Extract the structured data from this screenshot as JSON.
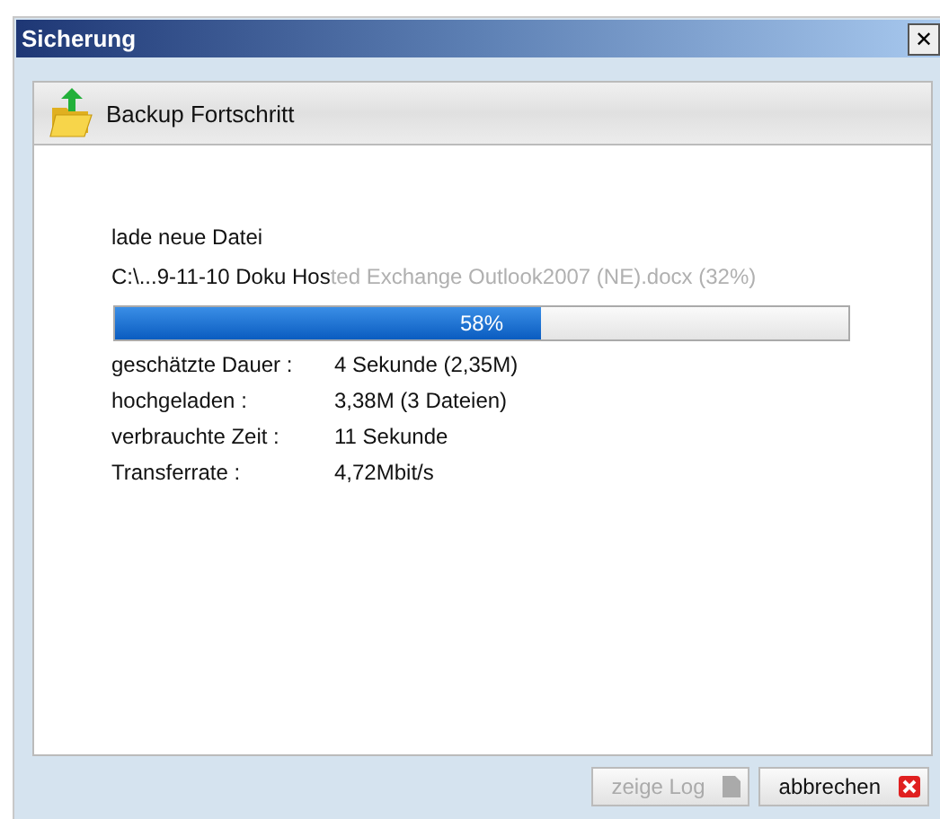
{
  "window": {
    "title": "Sicherung",
    "close": "✕"
  },
  "header": {
    "title": "Backup Fortschritt"
  },
  "status": "lade neue Datei",
  "file": {
    "done_part": "C:\\...9-11-10 Doku Hos",
    "rest_part": "ted Exchange Outlook2007 (NE).docx (32%)"
  },
  "progress": {
    "level": 0.58,
    "reading": "58%"
  },
  "stats": [
    {
      "label": "geschätzte Dauer :",
      "value": "4 Sekunde (2,35M)"
    },
    {
      "label": "hochgeladen :",
      "value": "3,38M (3 Dateien)"
    },
    {
      "label": "verbrauchte Zeit :",
      "value": "11 Sekunde"
    },
    {
      "label": "Transferrate :",
      "value": "4,72Mbit/s"
    }
  ],
  "buttons": [
    {
      "label": "zeige Log",
      "kind": "log",
      "disabled": true
    },
    {
      "label": "abbrechen",
      "kind": "cancel",
      "disabled": false
    }
  ]
}
